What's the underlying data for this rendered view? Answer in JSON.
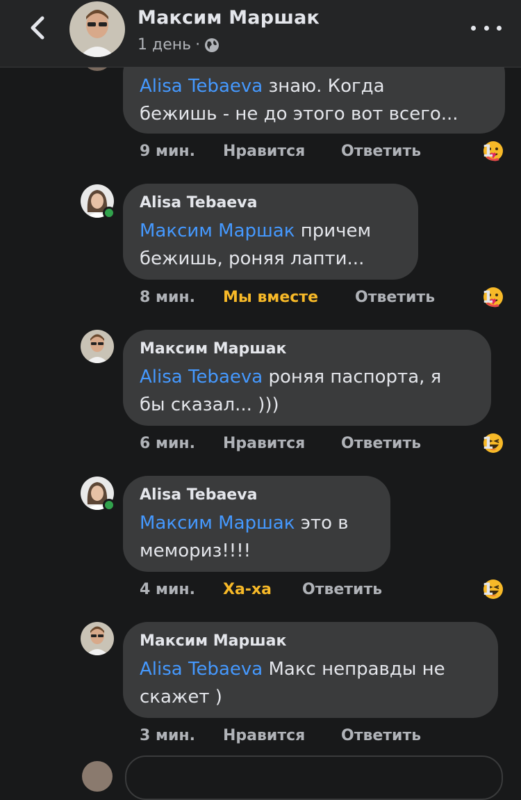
{
  "header": {
    "name": "Максим Маршак",
    "time": "1 день",
    "separator": "·",
    "privacy_icon": "globe-icon",
    "back_icon": "chevron-left-icon",
    "more_icon": "more-dots-icon"
  },
  "comments": [
    {
      "author": "",
      "mention": "Alisa Tebaeva",
      "text_line1": " знаю. Когда",
      "text_line2": "бежишь - не до этого вот всего...",
      "time": "9 мин.",
      "reaction_label": "Нравится",
      "reply_label": "Ответить",
      "count": "1",
      "emoji": "care-emoji"
    },
    {
      "author": "Alisa Tebaeva",
      "mention": "Максим Маршак",
      "text_line1": " причем",
      "text_line2": "бежишь, роняя лапти...",
      "time": "8 мин.",
      "reaction_label": "Мы вместе",
      "reply_label": "Ответить",
      "count": "1",
      "emoji": "care-emoji"
    },
    {
      "author": "Максим Маршак",
      "mention": "Alisa Tebaeva",
      "text_line1": " роняя паспорта, я",
      "text_line2": "бы сказал... )))",
      "time": "6 мин.",
      "reaction_label": "Нравится",
      "reply_label": "Ответить",
      "count": "1",
      "emoji": "haha-emoji"
    },
    {
      "author": "Alisa Tebaeva",
      "mention": "Максим Маршак",
      "text_line1": " это в",
      "text_line2": "мемориз!!!!",
      "time": "4 мин.",
      "reaction_label": "Ха-ха",
      "reply_label": "Ответить",
      "count": "1",
      "emoji": "haha-emoji"
    },
    {
      "author": "Максим Маршак",
      "mention": "Alisa Tebaeva",
      "text_line1": " Макс неправды не",
      "text_line2": "скажет )",
      "time": "3 мин.",
      "reaction_label": "Нравится",
      "reply_label": "Ответить",
      "count": "",
      "emoji": ""
    }
  ],
  "colors": {
    "background": "#18191a",
    "bubble": "#3a3b3c",
    "mention": "#4599ff",
    "active_reaction": "#f7b928",
    "online": "#31a24c"
  }
}
